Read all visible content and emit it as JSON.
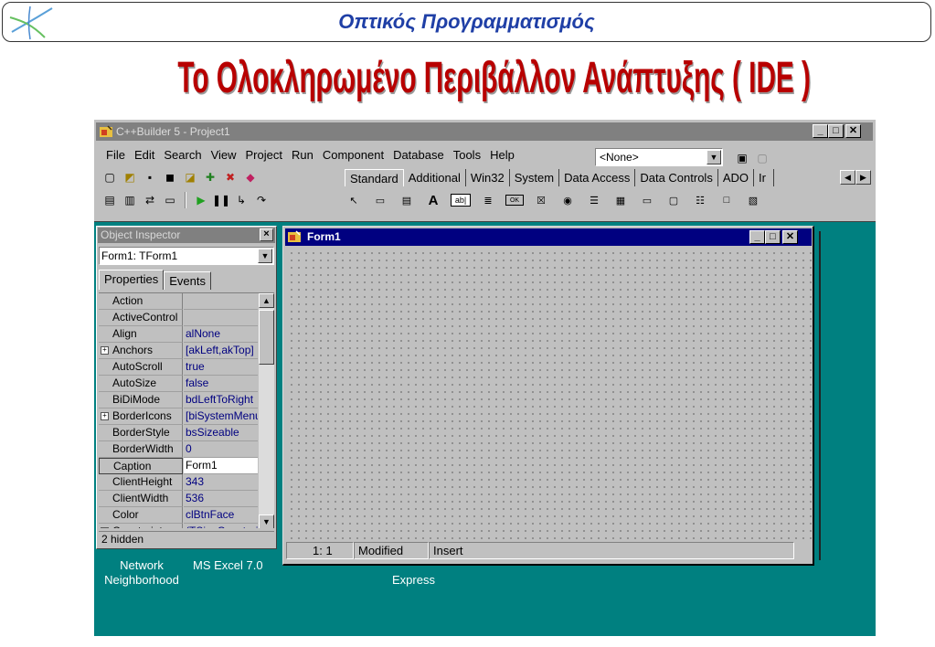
{
  "slide": {
    "header": "Οπτικός Προγραμματισμός",
    "title": "Το Ολοκληρωμένο Περιβάλλον Ανάπτυξης ( IDE )"
  },
  "main_window": {
    "title": "C++Builder 5 - Project1",
    "caption_buttons": [
      "_",
      "□",
      "✕"
    ],
    "menu": [
      "File",
      "Edit",
      "Search",
      "View",
      "Project",
      "Run",
      "Component",
      "Database",
      "Tools",
      "Help"
    ],
    "combo_value": "<None>",
    "palette_tabs": [
      "Standard",
      "Additional",
      "Win32",
      "System",
      "Data Access",
      "Data Controls",
      "ADO",
      "Ir"
    ],
    "palette_components": [
      "Arrow",
      "MainMenu",
      "PopupMenu",
      "Label",
      "Edit",
      "Memo",
      "Button",
      "CheckBox",
      "RadioButton",
      "ListBox",
      "ComboBox",
      "ScrollBar",
      "GroupBox",
      "RadioGroup",
      "Panel",
      "ActionList"
    ]
  },
  "object_inspector": {
    "title": "Object Inspector",
    "selected_object": "Form1: TForm1",
    "tabs": [
      "Properties",
      "Events"
    ],
    "properties": [
      {
        "name": "Action",
        "value": "",
        "expandable": false
      },
      {
        "name": "ActiveControl",
        "value": "",
        "expandable": false
      },
      {
        "name": "Align",
        "value": "alNone",
        "expandable": false
      },
      {
        "name": "Anchors",
        "value": "[akLeft,akTop]",
        "expandable": true
      },
      {
        "name": "AutoScroll",
        "value": "true",
        "expandable": false
      },
      {
        "name": "AutoSize",
        "value": "false",
        "expandable": false
      },
      {
        "name": "BiDiMode",
        "value": "bdLeftToRight",
        "expandable": false
      },
      {
        "name": "BorderIcons",
        "value": "[biSystemMenu]",
        "expandable": true
      },
      {
        "name": "BorderStyle",
        "value": "bsSizeable",
        "expandable": false
      },
      {
        "name": "BorderWidth",
        "value": "0",
        "expandable": false
      },
      {
        "name": "Caption",
        "value": "Form1",
        "expandable": false,
        "selected": true
      },
      {
        "name": "ClientHeight",
        "value": "343",
        "expandable": false
      },
      {
        "name": "ClientWidth",
        "value": "536",
        "expandable": false
      },
      {
        "name": "Color",
        "value": "clBtnFace",
        "expandable": false
      },
      {
        "name": "Constraints",
        "value": "(TSizeConstraints)",
        "expandable": true
      }
    ],
    "status": "2 hidden"
  },
  "form": {
    "title": "Form1",
    "status": {
      "position": "1: 1",
      "state": "Modified",
      "mode": "Insert"
    }
  },
  "desktop": {
    "icons": [
      "Network Neighborhood",
      "MS Excel 7.0",
      "Express"
    ]
  },
  "colors": {
    "slide_title": "#b80000",
    "header_text": "#1f3fa6",
    "desktop": "#008080",
    "active_titlebar": "#000080",
    "inactive_titlebar": "#808080"
  }
}
